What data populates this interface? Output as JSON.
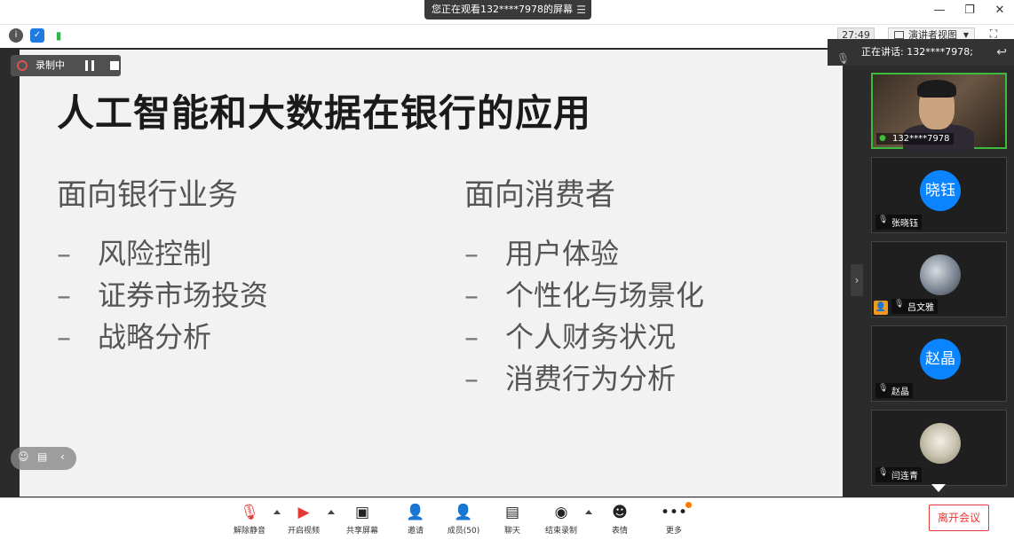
{
  "banner": {
    "text": "您正在观看132****7978的屏幕",
    "menu_icon": "menu-icon"
  },
  "timer": "27:49",
  "view_button": "演讲者视图",
  "recording": {
    "label": "录制中"
  },
  "speaker": {
    "text": "正在讲话: 132****7978;"
  },
  "slide": {
    "title": "人工智能和大数据在银行的应用",
    "left": {
      "heading": "面向银行业务",
      "items": [
        "风险控制",
        "证券市场投资",
        "战略分析"
      ]
    },
    "right": {
      "heading": "面向消费者",
      "items": [
        "用户体验",
        "个性化与场景化",
        "个人财务状况",
        "消费行为分析"
      ]
    },
    "dash": "–"
  },
  "participants": [
    {
      "name": "132****7978",
      "avatar": ""
    },
    {
      "name": "张晓钰",
      "avatar": "晓钰"
    },
    {
      "name": "吕文雅",
      "avatar": ""
    },
    {
      "name": "赵晶",
      "avatar": "赵晶"
    },
    {
      "name": "闫连青",
      "avatar": ""
    }
  ],
  "toolbar": {
    "mute": "解除静音",
    "video": "开启视频",
    "share": "共享屏幕",
    "invite": "邀请",
    "members": "成员(50)",
    "chat": "聊天",
    "stop_record": "结束录制",
    "reactions": "表情",
    "more": "更多",
    "leave": "离开会议"
  },
  "colors": {
    "accent": "#0a84ff",
    "danger": "#e53935",
    "active_speaker": "#3dbb3d"
  }
}
